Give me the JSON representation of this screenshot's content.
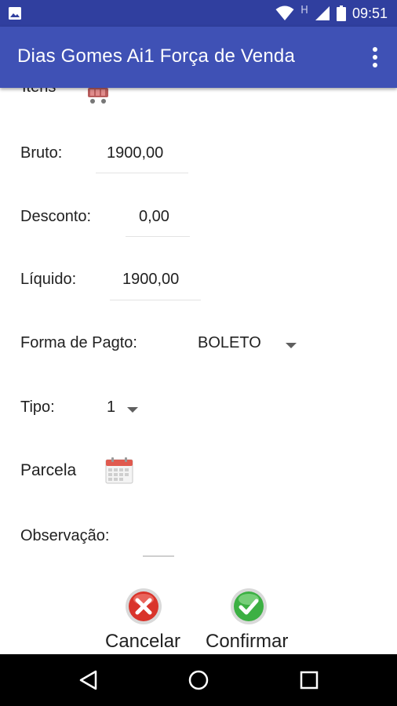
{
  "status_bar": {
    "time": "09:51",
    "network_indicator": "H",
    "icons": [
      "image-notification-icon",
      "wifi-icon",
      "signal-icon",
      "battery-icon"
    ]
  },
  "app_bar": {
    "title": "Dias Gomes Ai1 Força de Venda",
    "overflow_icon": "more-vert-icon"
  },
  "form": {
    "itens_label": "Itens",
    "bruto_label": "Bruto:",
    "bruto_value": "1900,00",
    "desconto_label": "Desconto:",
    "desconto_value": "0,00",
    "liquido_label": "Líquido:",
    "liquido_value": "1900,00",
    "forma_pagto_label": "Forma de Pagto:",
    "forma_pagto_value": "BOLETO",
    "tipo_label": "Tipo:",
    "tipo_value": "1",
    "parcela_label": "Parcela",
    "observacao_label": "Observação:",
    "observacao_value": ""
  },
  "actions": {
    "cancel_label": "Cancelar",
    "confirm_label": "Confirmar"
  },
  "colors": {
    "status_bar": "#303f9f",
    "app_bar": "#3f51b5",
    "cancel": "#d9342b",
    "confirm": "#3cb043"
  }
}
